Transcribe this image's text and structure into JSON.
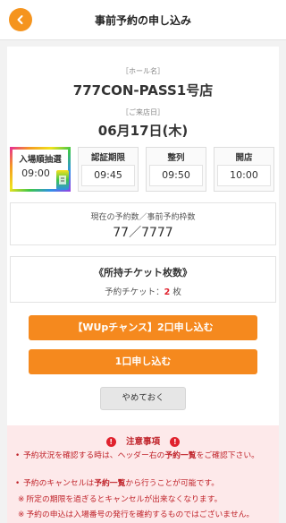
{
  "header": {
    "title": "事前予約の申し込み",
    "back_icon": "chevron-left-icon",
    "accent": "#f5941e"
  },
  "hall": {
    "label": "［ホール名］",
    "name": "777CON-PASS1号店"
  },
  "visit": {
    "label": "［ご来店日］",
    "date": "06月17日(木)"
  },
  "schedule": [
    {
      "label": "入場順抽選",
      "time": "09:00"
    },
    {
      "label": "認証期限",
      "time": "09:45"
    },
    {
      "label": "整列",
      "time": "09:50"
    },
    {
      "label": "開店",
      "time": "10:00"
    }
  ],
  "reservation": {
    "label": "現在の予約数／事前予約枠数",
    "value": "77／7777"
  },
  "tickets": {
    "title": "《所持チケット枚数》",
    "prefix": "予約チケット：",
    "count": "2",
    "unit": " 枚"
  },
  "buttons": {
    "wup": "【WUpチャンス】2口申し込む",
    "single": "1口申し込む",
    "cancel": "やめておく"
  },
  "notice": {
    "title": "注意事項",
    "item1_a": "予約状況を確認する時は、ヘッダー右の",
    "item1_b": "予約一覧",
    "item1_c": "をご確認下さい。",
    "item2_a": "予約のキャンセルは",
    "item2_b": "予約一覧",
    "item2_c": "から行うことが可能です。",
    "item3": "所定の期限を過ぎるとキャンセルが出来なくなります。",
    "item4": "予約の申込は入場番号の発行を確約するものではございません。"
  }
}
